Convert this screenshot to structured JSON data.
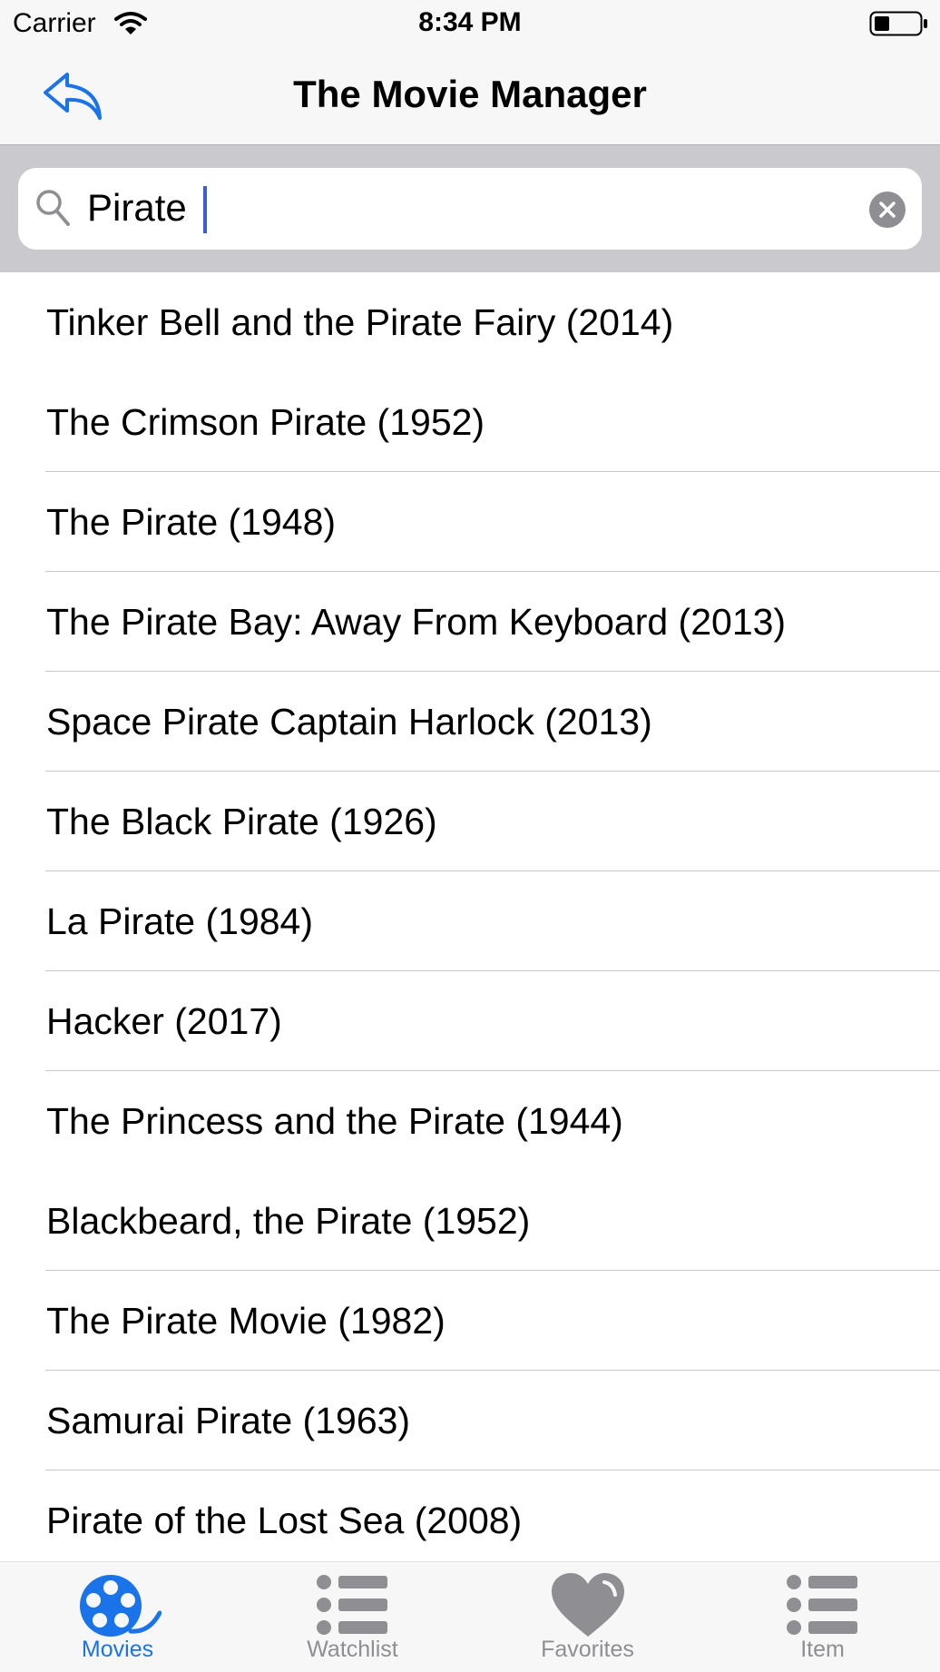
{
  "status_bar": {
    "carrier": "Carrier",
    "time": "8:34 PM",
    "battery_level": 0.3
  },
  "nav": {
    "title": "The Movie Manager",
    "back_icon": "reply-arrow-icon"
  },
  "search": {
    "value": "Pirate",
    "placeholder": ""
  },
  "movies": [
    {
      "title": "Tinker Bell and the Pirate Fairy (2014)"
    },
    {
      "title": "The Crimson Pirate (1952)"
    },
    {
      "title": "The Pirate (1948)"
    },
    {
      "title": "The Pirate Bay: Away From Keyboard (2013)"
    },
    {
      "title": "Space Pirate Captain Harlock (2013)"
    },
    {
      "title": "The Black Pirate (1926)"
    },
    {
      "title": "La Pirate (1984)"
    },
    {
      "title": "Hacker (2017)"
    },
    {
      "title": "The Princess and the Pirate (1944)"
    },
    {
      "title": "Blackbeard, the Pirate (1952)"
    },
    {
      "title": "The Pirate Movie (1982)"
    },
    {
      "title": "Samurai Pirate (1963)"
    },
    {
      "title": "Pirate of the Lost Sea (2008)"
    }
  ],
  "tabs": [
    {
      "label": "Movies",
      "icon": "film-reel-icon",
      "active": true
    },
    {
      "label": "Watchlist",
      "icon": "list-icon",
      "active": false
    },
    {
      "label": "Favorites",
      "icon": "heart-icon",
      "active": false
    },
    {
      "label": "Item",
      "icon": "list-icon",
      "active": false
    }
  ],
  "colors": {
    "accent": "#1a73e8",
    "inactive": "#8e8e93"
  }
}
